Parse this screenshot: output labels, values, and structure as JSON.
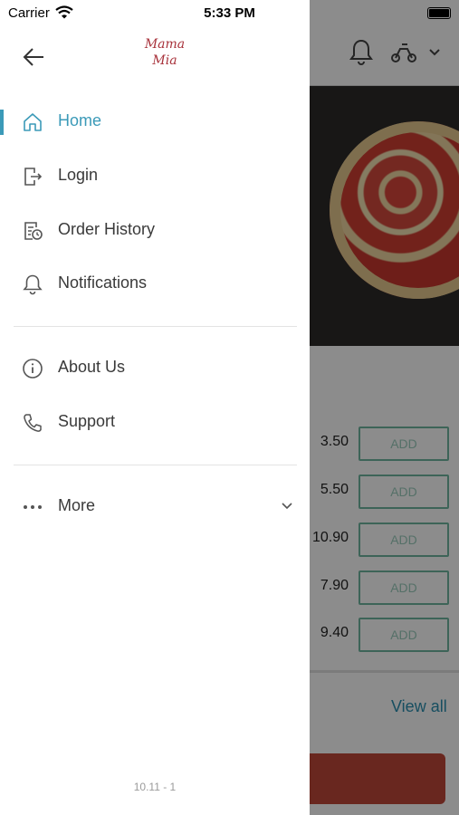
{
  "status_bar": {
    "carrier": "Carrier",
    "time": "5:33 PM"
  },
  "drawer": {
    "logo_line1": "Mama",
    "logo_line2": "Mia",
    "items": [
      {
        "label": "Home",
        "icon": "home-icon",
        "active": true
      },
      {
        "label": "Login",
        "icon": "login-icon"
      },
      {
        "label": "Order History",
        "icon": "order-history-icon"
      },
      {
        "label": "Notifications",
        "icon": "bell-icon"
      },
      {
        "label": "About Us",
        "icon": "info-icon"
      },
      {
        "label": "Support",
        "icon": "phone-icon"
      },
      {
        "label": "More",
        "icon": "more-dots-icon"
      }
    ],
    "version": "10.11 - 1"
  },
  "background": {
    "prices": [
      "3.50",
      "5.50",
      "10.90",
      "7.90",
      "9.40"
    ],
    "add_label": "ADD",
    "view_all": "View all"
  },
  "colors": {
    "accent": "#3b9ab8",
    "brand": "#a8323b"
  }
}
